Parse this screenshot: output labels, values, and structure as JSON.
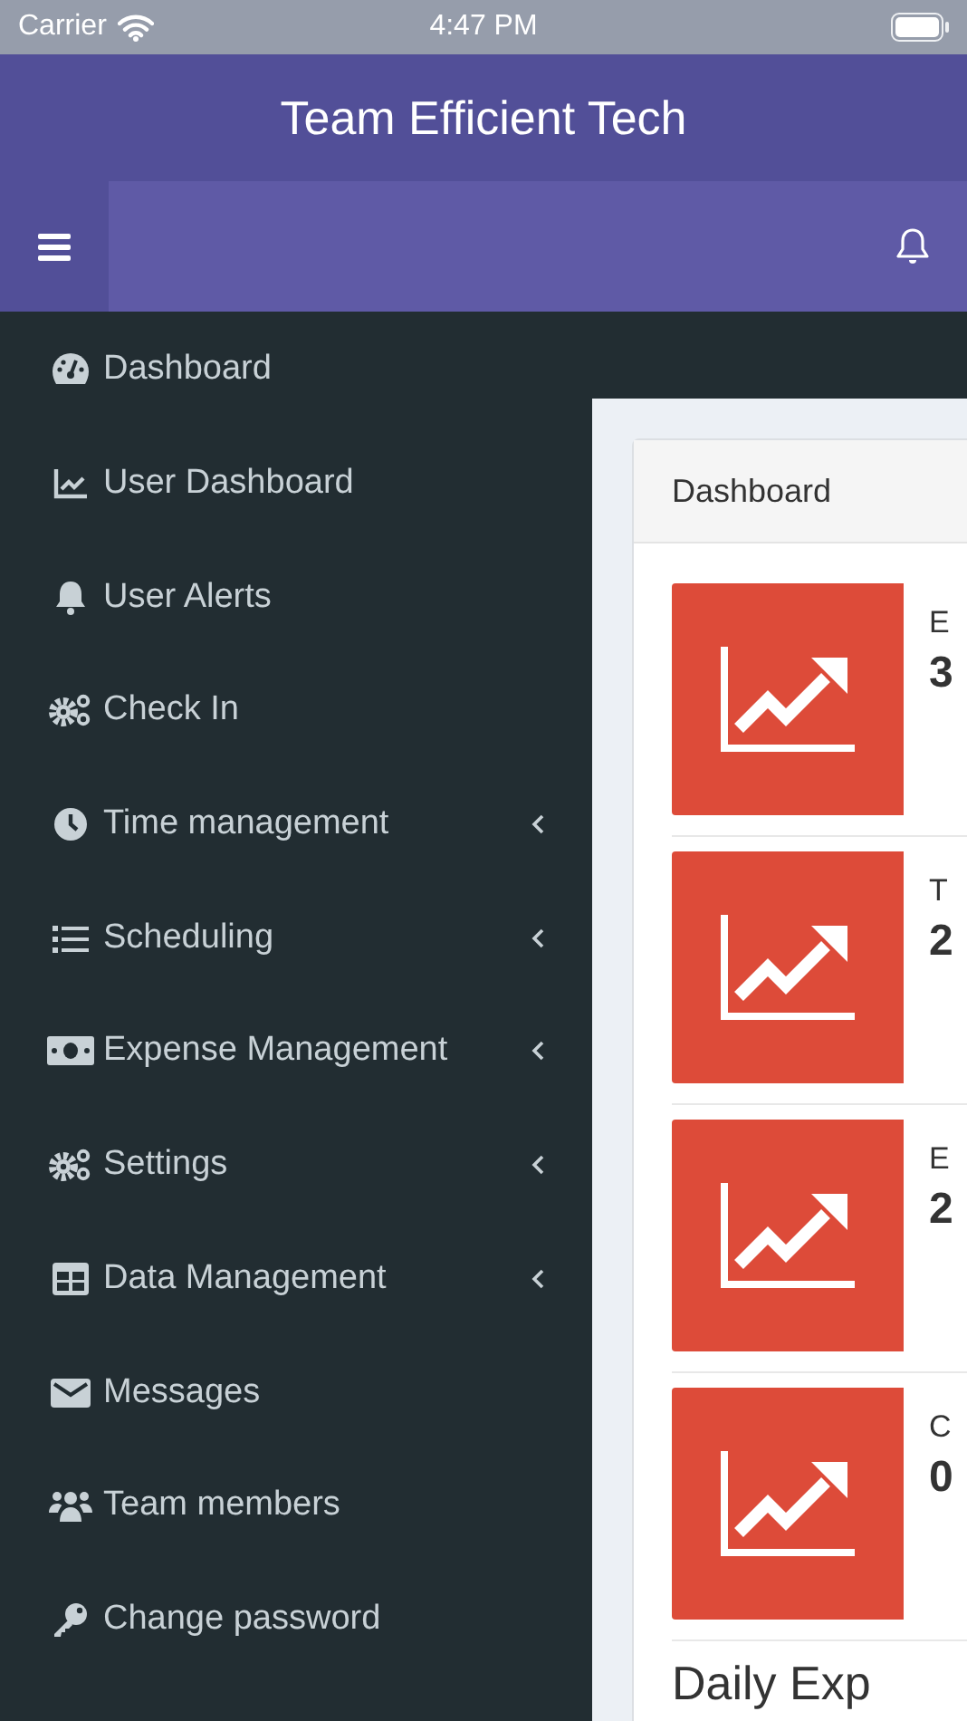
{
  "status_bar": {
    "carrier": "Carrier",
    "time": "4:47 PM"
  },
  "header": {
    "title": "Team Efficient Tech"
  },
  "sidebar": {
    "items": [
      {
        "label": "Dashboard",
        "expandable": false
      },
      {
        "label": "User Dashboard",
        "expandable": false
      },
      {
        "label": "User Alerts",
        "expandable": false
      },
      {
        "label": "Check In",
        "expandable": false
      },
      {
        "label": "Time management",
        "expandable": true
      },
      {
        "label": "Scheduling",
        "expandable": true
      },
      {
        "label": "Expense Management",
        "expandable": true
      },
      {
        "label": "Settings",
        "expandable": true
      },
      {
        "label": "Data Management",
        "expandable": true
      },
      {
        "label": "Messages",
        "expandable": false
      },
      {
        "label": "Team members",
        "expandable": false
      },
      {
        "label": "Change password",
        "expandable": false
      }
    ]
  },
  "content": {
    "panel_title": "Dashboard",
    "tiles": [
      {
        "label": "E",
        "value": "3"
      },
      {
        "label": "T",
        "value": "2"
      },
      {
        "label": "E",
        "value": "2"
      },
      {
        "label": "C",
        "value": "0"
      }
    ],
    "section_heading": "Daily Exp"
  }
}
